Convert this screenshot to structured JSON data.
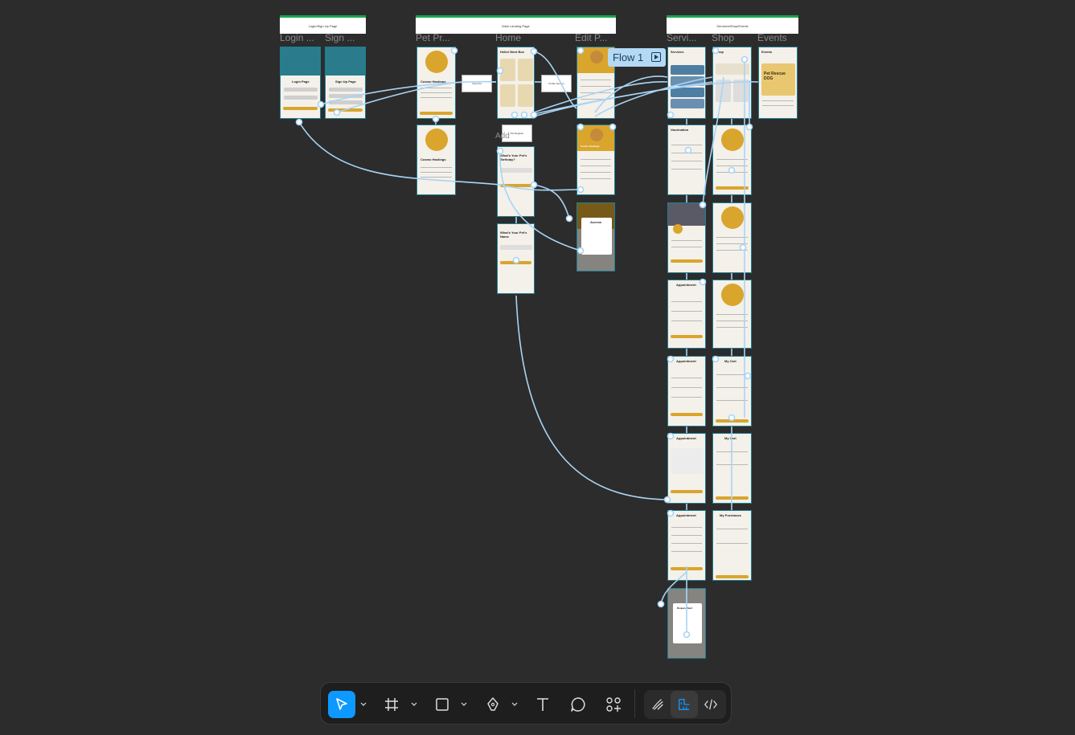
{
  "sections": [
    {
      "id": "login",
      "title": "Login/Sign Up Page"
    },
    {
      "id": "main",
      "title": "Main Landing Page"
    },
    {
      "id": "services",
      "title": "Services/Shop/Events"
    }
  ],
  "frame_labels": {
    "login": "Login ...",
    "signup": "Sign ...",
    "pet_profile": "Pet Pr...",
    "home": "Home",
    "edit_profile": "Edit P...",
    "services": "Servi...",
    "shop": "Shop",
    "events": "Events"
  },
  "frames": {
    "login_page": "Login Page",
    "signup_page": "Sign Up Page",
    "pet_name": "Cosmo Hastings",
    "home_hello": "Hello! Meet Box",
    "edit_name": "Cosmo Hastings",
    "question_birthday": "What's Your Pet's Birthday?",
    "question_name": "What's Your Pet's Name",
    "pet_register": "Pet Register",
    "add": "Add",
    "services_title": "Services",
    "shop_title": "Shop",
    "events_title": "Events",
    "event_poster": "Pet Rescue DOG",
    "vaccination": "Vaccination",
    "appointment": "Appointment",
    "my_cart": "My Cart",
    "my_purchases": "My Purchases",
    "popup_view": "View Pet",
    "popup_profile": "Profile Section",
    "access_title": "Access",
    "request_sent": "Request Sent"
  },
  "flow": {
    "label": "Flow 1",
    "icon": "play-flow-icon"
  },
  "toolbar": {
    "tools": [
      {
        "name": "move-tool",
        "icon": "cursor-icon",
        "active": true
      },
      {
        "name": "frame-tool",
        "icon": "frame-hash-icon"
      },
      {
        "name": "shape-tool",
        "icon": "rectangle-icon"
      },
      {
        "name": "pen-tool",
        "icon": "pen-icon"
      },
      {
        "name": "text-tool",
        "icon": "text-T-icon"
      },
      {
        "name": "comment-tool",
        "icon": "comment-bubble-icon"
      },
      {
        "name": "actions-tool",
        "icon": "components-plus-icon"
      },
      {
        "name": "draw-mode",
        "icon": "draw-pencil-icon"
      },
      {
        "name": "design-mode",
        "icon": "design-ruler-icon",
        "selected": true
      },
      {
        "name": "dev-mode",
        "icon": "code-brackets-icon"
      }
    ]
  },
  "colors": {
    "canvas": "#2c2c2c",
    "flow": "#b3d9f5",
    "accent": "#0d99ff",
    "brand_gold": "#d9a52d",
    "frame_border": "#1f7e93"
  }
}
